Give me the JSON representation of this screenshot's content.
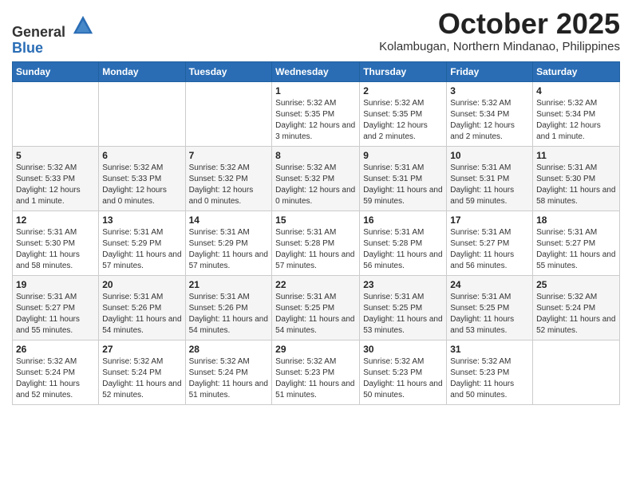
{
  "header": {
    "logo_line1": "General",
    "logo_line2": "Blue",
    "month": "October 2025",
    "location": "Kolambugan, Northern Mindanao, Philippines"
  },
  "weekdays": [
    "Sunday",
    "Monday",
    "Tuesday",
    "Wednesday",
    "Thursday",
    "Friday",
    "Saturday"
  ],
  "weeks": [
    [
      {
        "day": "",
        "info": ""
      },
      {
        "day": "",
        "info": ""
      },
      {
        "day": "",
        "info": ""
      },
      {
        "day": "1",
        "info": "Sunrise: 5:32 AM\nSunset: 5:35 PM\nDaylight: 12 hours and 3 minutes."
      },
      {
        "day": "2",
        "info": "Sunrise: 5:32 AM\nSunset: 5:35 PM\nDaylight: 12 hours and 2 minutes."
      },
      {
        "day": "3",
        "info": "Sunrise: 5:32 AM\nSunset: 5:34 PM\nDaylight: 12 hours and 2 minutes."
      },
      {
        "day": "4",
        "info": "Sunrise: 5:32 AM\nSunset: 5:34 PM\nDaylight: 12 hours and 1 minute."
      }
    ],
    [
      {
        "day": "5",
        "info": "Sunrise: 5:32 AM\nSunset: 5:33 PM\nDaylight: 12 hours and 1 minute."
      },
      {
        "day": "6",
        "info": "Sunrise: 5:32 AM\nSunset: 5:33 PM\nDaylight: 12 hours and 0 minutes."
      },
      {
        "day": "7",
        "info": "Sunrise: 5:32 AM\nSunset: 5:32 PM\nDaylight: 12 hours and 0 minutes."
      },
      {
        "day": "8",
        "info": "Sunrise: 5:32 AM\nSunset: 5:32 PM\nDaylight: 12 hours and 0 minutes."
      },
      {
        "day": "9",
        "info": "Sunrise: 5:31 AM\nSunset: 5:31 PM\nDaylight: 11 hours and 59 minutes."
      },
      {
        "day": "10",
        "info": "Sunrise: 5:31 AM\nSunset: 5:31 PM\nDaylight: 11 hours and 59 minutes."
      },
      {
        "day": "11",
        "info": "Sunrise: 5:31 AM\nSunset: 5:30 PM\nDaylight: 11 hours and 58 minutes."
      }
    ],
    [
      {
        "day": "12",
        "info": "Sunrise: 5:31 AM\nSunset: 5:30 PM\nDaylight: 11 hours and 58 minutes."
      },
      {
        "day": "13",
        "info": "Sunrise: 5:31 AM\nSunset: 5:29 PM\nDaylight: 11 hours and 57 minutes."
      },
      {
        "day": "14",
        "info": "Sunrise: 5:31 AM\nSunset: 5:29 PM\nDaylight: 11 hours and 57 minutes."
      },
      {
        "day": "15",
        "info": "Sunrise: 5:31 AM\nSunset: 5:28 PM\nDaylight: 11 hours and 57 minutes."
      },
      {
        "day": "16",
        "info": "Sunrise: 5:31 AM\nSunset: 5:28 PM\nDaylight: 11 hours and 56 minutes."
      },
      {
        "day": "17",
        "info": "Sunrise: 5:31 AM\nSunset: 5:27 PM\nDaylight: 11 hours and 56 minutes."
      },
      {
        "day": "18",
        "info": "Sunrise: 5:31 AM\nSunset: 5:27 PM\nDaylight: 11 hours and 55 minutes."
      }
    ],
    [
      {
        "day": "19",
        "info": "Sunrise: 5:31 AM\nSunset: 5:27 PM\nDaylight: 11 hours and 55 minutes."
      },
      {
        "day": "20",
        "info": "Sunrise: 5:31 AM\nSunset: 5:26 PM\nDaylight: 11 hours and 54 minutes."
      },
      {
        "day": "21",
        "info": "Sunrise: 5:31 AM\nSunset: 5:26 PM\nDaylight: 11 hours and 54 minutes."
      },
      {
        "day": "22",
        "info": "Sunrise: 5:31 AM\nSunset: 5:25 PM\nDaylight: 11 hours and 54 minutes."
      },
      {
        "day": "23",
        "info": "Sunrise: 5:31 AM\nSunset: 5:25 PM\nDaylight: 11 hours and 53 minutes."
      },
      {
        "day": "24",
        "info": "Sunrise: 5:31 AM\nSunset: 5:25 PM\nDaylight: 11 hours and 53 minutes."
      },
      {
        "day": "25",
        "info": "Sunrise: 5:32 AM\nSunset: 5:24 PM\nDaylight: 11 hours and 52 minutes."
      }
    ],
    [
      {
        "day": "26",
        "info": "Sunrise: 5:32 AM\nSunset: 5:24 PM\nDaylight: 11 hours and 52 minutes."
      },
      {
        "day": "27",
        "info": "Sunrise: 5:32 AM\nSunset: 5:24 PM\nDaylight: 11 hours and 52 minutes."
      },
      {
        "day": "28",
        "info": "Sunrise: 5:32 AM\nSunset: 5:24 PM\nDaylight: 11 hours and 51 minutes."
      },
      {
        "day": "29",
        "info": "Sunrise: 5:32 AM\nSunset: 5:23 PM\nDaylight: 11 hours and 51 minutes."
      },
      {
        "day": "30",
        "info": "Sunrise: 5:32 AM\nSunset: 5:23 PM\nDaylight: 11 hours and 50 minutes."
      },
      {
        "day": "31",
        "info": "Sunrise: 5:32 AM\nSunset: 5:23 PM\nDaylight: 11 hours and 50 minutes."
      },
      {
        "day": "",
        "info": ""
      }
    ]
  ]
}
